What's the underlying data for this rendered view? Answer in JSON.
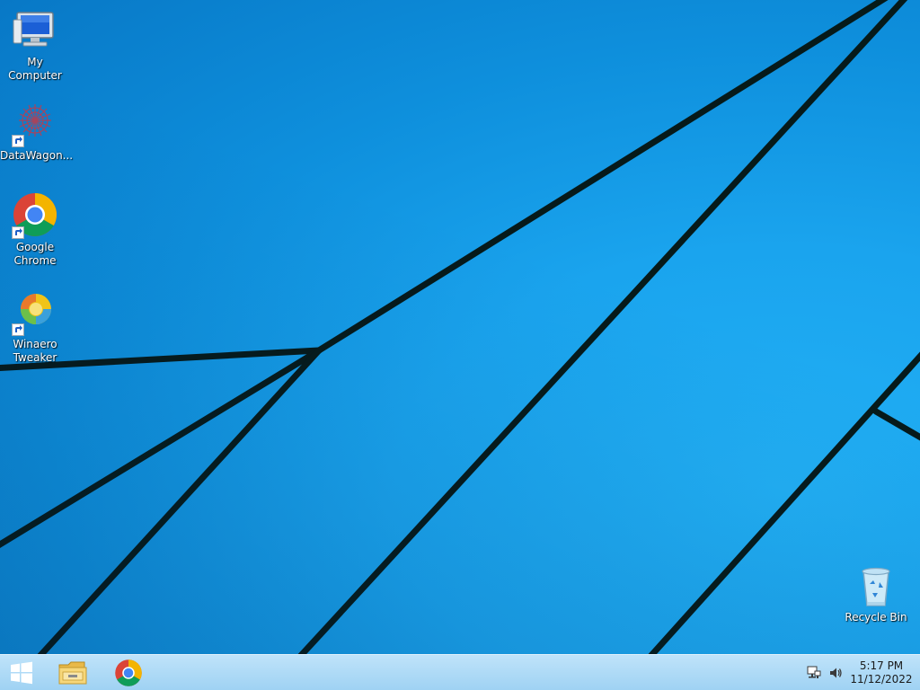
{
  "desktop": {
    "wallpaper_color": "#1aa4ee",
    "line_color": "#061a1a",
    "icons": [
      {
        "label": "My Computer",
        "icon": "computer-icon"
      },
      {
        "label": "DataWagon...",
        "icon": "datawagon-icon"
      },
      {
        "label": "Google\nChrome",
        "icon": "chrome-icon"
      },
      {
        "label": "Winaero\nTweaker",
        "icon": "winaero-tweaker-icon"
      },
      {
        "label": "Recycle Bin",
        "icon": "recycle-bin-icon"
      }
    ]
  },
  "taskbar": {
    "background": "#a8d8f5",
    "start_icon": "windows-logo-icon",
    "pinned": [
      {
        "name": "File Explorer",
        "icon": "folder-icon"
      },
      {
        "name": "Google Chrome",
        "icon": "chrome-icon"
      }
    ],
    "tray": {
      "network_icon": "network-icon",
      "volume_icon": "volume-icon",
      "time": "5:17 PM",
      "date": "11/12/2022"
    }
  }
}
